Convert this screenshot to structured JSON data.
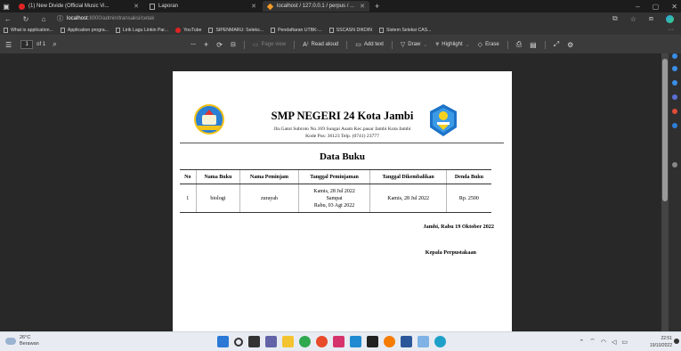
{
  "browser": {
    "tabs": [
      {
        "label": "(1) New Divide (Official Music Vi...",
        "icon": "youtube-icon"
      },
      {
        "label": "Laporan",
        "icon": "document-icon"
      },
      {
        "label": "localhost / 127.0.0.1 / perpus / ...",
        "icon": "phpmyadmin-icon"
      }
    ],
    "new_tab": "+",
    "window_controls": {
      "minimize": "–",
      "maximize": "▢",
      "close": "✕"
    },
    "url_host": "localhost",
    "url_path": ":8000/admin/transaksi/cetak",
    "bookmarks": [
      {
        "label": "What is application...",
        "icon": "document-icon"
      },
      {
        "label": "Application progra...",
        "icon": "document-icon"
      },
      {
        "label": "Lirik Lagu Linkin Par...",
        "icon": "document-icon"
      },
      {
        "label": "YouTube",
        "icon": "youtube-icon"
      },
      {
        "label": "SIPENMARU: Seleks...",
        "icon": "document-icon"
      },
      {
        "label": "Pendaftaran UTBK-...",
        "icon": "document-icon"
      },
      {
        "label": "SSCASN DIKDIN",
        "icon": "document-icon"
      },
      {
        "label": "Sistem Seleksi CAS...",
        "icon": "document-icon"
      }
    ],
    "bookmarks_more": "···",
    "address_icons": {
      "collections": "⧉",
      "favorites": "☆",
      "extensions": "⧈"
    }
  },
  "pdf_toolbar": {
    "page_current": "1",
    "page_of": "of 1",
    "zoom_out": "—",
    "zoom_in": "+",
    "page_view": "Page view",
    "read_aloud": "Read aloud",
    "add_text": "Add text",
    "draw": "Draw",
    "highlight": "Highlight",
    "erase": "Erase"
  },
  "document": {
    "school_name": "SMP NEGERI 24 Kota Jambi",
    "address_line1": "Jln.Gatot Subroto No.169 Sungai Asam Kec.pasar Jambi Kota Jambi",
    "address_line2": "Kode Pos: 36123 Telp. (0741) 23777",
    "title": "Data Buku",
    "table": {
      "columns": [
        "No",
        "Nama Buku",
        "Nama Peminjam",
        "Tanggal Peminjaman",
        "Tanggal Dikembalikan",
        "Denda Buku"
      ],
      "rows": [
        {
          "no": "1",
          "nama_buku": "biologi",
          "nama_peminjam": "zurayah",
          "tanggal_peminjaman": [
            "Kamis, 28 Jul 2022",
            "Sampai",
            "Rabu, 03 Agt 2022"
          ],
          "tanggal_dikembalikan": "Kamis, 28 Jul 2022",
          "denda": "Rp. 2500"
        }
      ]
    },
    "place_date": "Jambi, Rabu 19 Oktober 2022",
    "signature_title": "Kepala Perpustakaan"
  },
  "taskbar": {
    "weather_temp": "26°C",
    "weather_desc": "Berawan",
    "time": "22:51",
    "date": "19/10/2022"
  }
}
